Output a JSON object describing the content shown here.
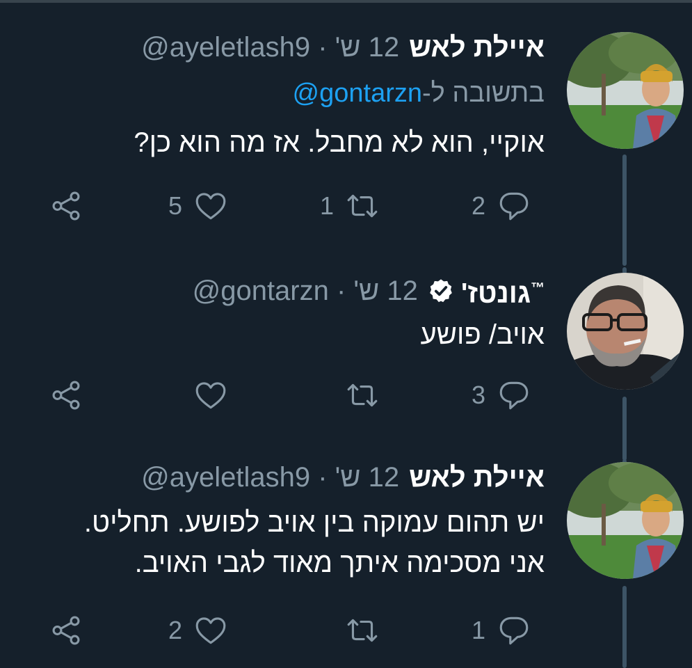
{
  "tweets": [
    {
      "display_name": "איילת לאש",
      "handle": "@ayeletlash9",
      "time": "12 ש'",
      "reply_prefix": "בתשובה ל-",
      "reply_mention": "@gontarzn",
      "lines": [
        "אוקיי, הוא לא מחבל. אז מה הוא כן?"
      ],
      "counts": {
        "reply": "2",
        "retweet": "1",
        "like": "5"
      }
    },
    {
      "display_name": "גונטז'",
      "trademark": "™",
      "verified": true,
      "handle": "@gontarzn",
      "time": "12 ש'",
      "lines": [
        "אויב/ פושע"
      ],
      "counts": {
        "reply": "3",
        "retweet": "",
        "like": ""
      }
    },
    {
      "display_name": "איילת לאש",
      "handle": "@ayeletlash9",
      "time": "12 ש'",
      "lines": [
        "יש תהום עמוקה בין אויב לפושע. תחליט.",
        "אני מסכימה איתך מאוד לגבי האויב."
      ],
      "counts": {
        "reply": "1",
        "retweet": "",
        "like": "2"
      }
    }
  ],
  "separator": " · ",
  "colors": {
    "background": "#15202b",
    "secondary_text": "#8899a6",
    "link": "#1da1f2",
    "thread_line": "#3d5466"
  },
  "icons": {
    "reply": "reply-icon",
    "retweet": "retweet-icon",
    "like": "heart-icon",
    "share": "share-icon",
    "verified": "verified-badge-icon"
  }
}
